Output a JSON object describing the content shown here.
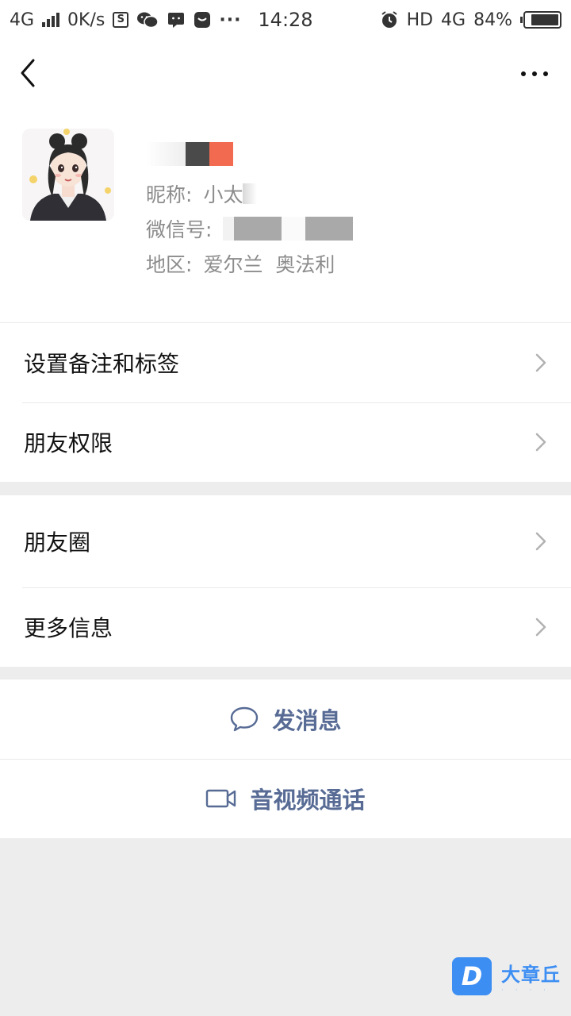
{
  "status_bar": {
    "network": "4G",
    "speed": "0K/s",
    "time": "14:28",
    "hd": "HD",
    "network_right": "4G",
    "battery": "84%",
    "more": "···"
  },
  "profile": {
    "nickname_label": "昵称:",
    "nickname_value": "小太",
    "wechat_id_label": "微信号:",
    "region_label": "地区:",
    "region_value": "爱尔兰  奥法利"
  },
  "menu_group_1": [
    {
      "label": "设置备注和标签"
    },
    {
      "label": "朋友权限"
    }
  ],
  "menu_group_2": [
    {
      "label": "朋友圈"
    },
    {
      "label": "更多信息"
    }
  ],
  "actions": {
    "message_label": "发消息",
    "call_label": "音视频通话"
  },
  "watermark": {
    "logo": "D",
    "title": "大章丘"
  },
  "colors": {
    "accent": "#576b95",
    "background": "#ededed",
    "watermark": "#3d8ef3"
  }
}
